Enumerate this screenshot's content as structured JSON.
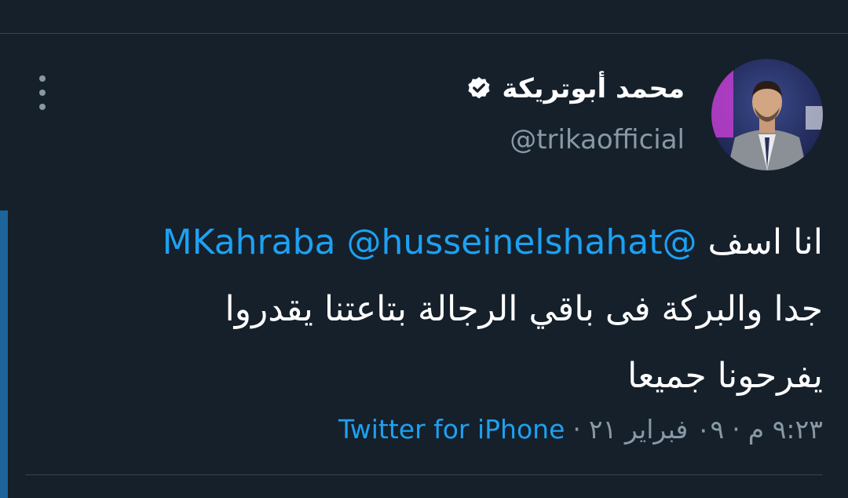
{
  "author": {
    "display_name": "محمد أبوتريكة",
    "handle": "@trikaofficial",
    "avatar_icon": "profile-photo",
    "verified_icon": "verified-badge-icon"
  },
  "tweet": {
    "mention_1": "@husseinelshahat",
    "mention_2": "@MKahraba",
    "text_after_mentions": "انا اسف",
    "line_2": "جدا والبركة فى باقي الرجالة بتاعتنا يقدروا",
    "line_3": "يفرحونا جميعا"
  },
  "meta": {
    "time": "٩:٢٣ م",
    "date": "٠٩ فبراير ٢١",
    "separator": "·",
    "source": "Twitter for iPhone"
  },
  "colors": {
    "background": "#15202b",
    "link": "#1da1f2",
    "muted": "#8899a6",
    "divider": "#38444d"
  }
}
